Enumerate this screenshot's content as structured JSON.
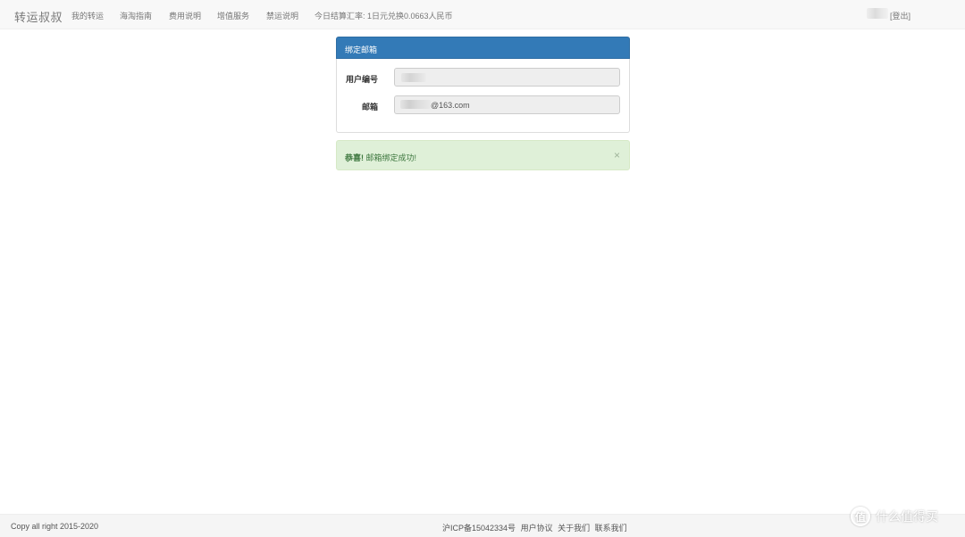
{
  "navbar": {
    "brand": "转运叔叔",
    "items": [
      {
        "label": "我的转运"
      },
      {
        "label": "海淘指南"
      },
      {
        "label": "费用说明"
      },
      {
        "label": "增值服务"
      },
      {
        "label": "禁运说明"
      }
    ],
    "rate_text": "今日结算汇率: 1日元兑换0.0663人民币",
    "logout_label": "[登出]"
  },
  "panel": {
    "title": "绑定邮箱",
    "fields": {
      "user_id_label": "用户编号",
      "email_label": "邮箱",
      "email_value_suffix": "@163.com"
    }
  },
  "alert": {
    "strong": "恭喜!",
    "message": " 邮箱绑定成功!",
    "close": "×"
  },
  "footer": {
    "copyright": "Copy all right 2015-2020",
    "links": [
      "沪ICP备15042334号",
      "用户协议",
      "关于我们",
      "联系我们"
    ]
  },
  "watermark": {
    "logo_char": "值",
    "text": "什么值得买"
  },
  "colors": {
    "panel_heading": "#337ab7",
    "alert_bg": "#dff0d8",
    "alert_text": "#3c763d",
    "navbar_bg": "#f8f8f8"
  }
}
